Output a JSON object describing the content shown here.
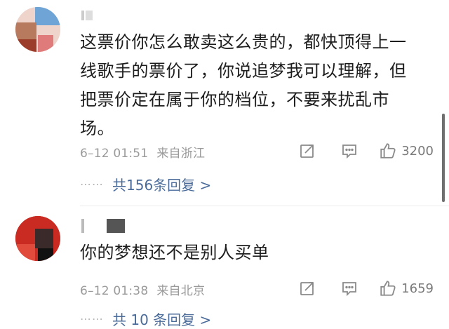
{
  "comments": [
    {
      "text_lines": [
        "这票价你怎么敢卖这么贵的，都快顶得上一",
        "线歌手的票价了，你说追梦我可以理解，但",
        "把票价定在属于你的档位，不要来扰乱市",
        "场。"
      ],
      "date": "6–12 01:51",
      "location": "来自浙江",
      "likes": "3200",
      "replies_text": "共156条回复 >"
    },
    {
      "text_lines": [
        "你的梦想还不是别人买单"
      ],
      "date": "6–12 01:38",
      "location": "来自北京",
      "likes": "1659",
      "replies_text": "共 10 条回复 >"
    }
  ],
  "reply_dots": "⋯⋯",
  "icons": {
    "share": "share-icon",
    "comment": "comment-icon",
    "like": "thumbs-up-icon"
  },
  "colors": {
    "reply_link": "#4a6b9a",
    "meta_text": "#9a9a9a"
  }
}
